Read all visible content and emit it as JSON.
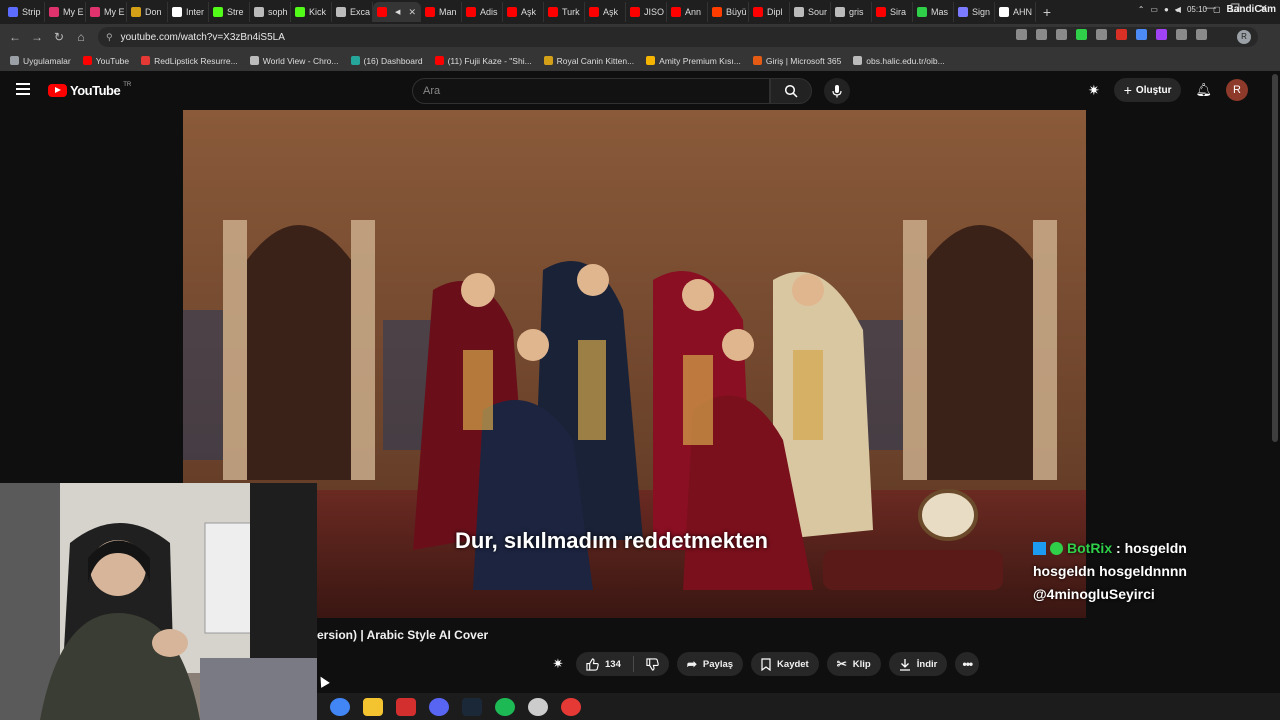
{
  "browser": {
    "tabs": [
      {
        "label": "Strip",
        "favicon": "#5b6cff"
      },
      {
        "label": "My E",
        "favicon": "#e0336e"
      },
      {
        "label": "My E",
        "favicon": "#e0336e"
      },
      {
        "label": "Don",
        "favicon": "#d4a017"
      },
      {
        "label": "Inter",
        "favicon": "#ffffff"
      },
      {
        "label": "Stre",
        "favicon": "#53fc18"
      },
      {
        "label": "soph",
        "favicon": "#bbbbbb"
      },
      {
        "label": "Kick",
        "favicon": "#53fc18"
      },
      {
        "label": "Exca",
        "favicon": "#bbbbbb"
      },
      {
        "label": "",
        "favicon": "#ff0000",
        "active": true
      },
      {
        "label": "Man",
        "favicon": "#ff0000"
      },
      {
        "label": "Adis",
        "favicon": "#ff0000"
      },
      {
        "label": "Aşk",
        "favicon": "#ff0000"
      },
      {
        "label": "Turk",
        "favicon": "#ff0000"
      },
      {
        "label": "Aşk",
        "favicon": "#ff0000"
      },
      {
        "label": "JISO",
        "favicon": "#ff0000"
      },
      {
        "label": "Ann",
        "favicon": "#ff0000"
      },
      {
        "label": "Büyü",
        "favicon": "#ff3d00"
      },
      {
        "label": "Dipl",
        "favicon": "#ff0000"
      },
      {
        "label": "Sour",
        "favicon": "#bbbbbb"
      },
      {
        "label": "gris",
        "favicon": "#bbbbbb"
      },
      {
        "label": "Sira",
        "favicon": "#ff0000"
      },
      {
        "label": "Mas",
        "favicon": "#2fcf4a"
      },
      {
        "label": "Sign",
        "favicon": "#7b7bff"
      },
      {
        "label": "AHN",
        "favicon": "#ffffff"
      }
    ],
    "url": "youtube.com/watch?v=X3zBn4iS5LA",
    "profile_initial": "R",
    "bookmarks": [
      {
        "label": "Uygulamalar",
        "color": "#9aa0a6"
      },
      {
        "label": "YouTube",
        "color": "#ff0000"
      },
      {
        "label": "RedLipstick Resurre...",
        "color": "#e53935"
      },
      {
        "label": "World View - Chro...",
        "color": "#bbbbbb"
      },
      {
        "label": "(16) Dashboard",
        "color": "#26a69a"
      },
      {
        "label": "(11) Fujii Kaze - \"Shi...",
        "color": "#ff0000"
      },
      {
        "label": "Royal Canin Kitten...",
        "color": "#d4a017"
      },
      {
        "label": "Amity Premium Kısı...",
        "color": "#f4b400"
      },
      {
        "label": "Giriş | Microsoft 365",
        "color": "#e55b13"
      },
      {
        "label": "obs.halic.edu.tr/oib...",
        "color": "#bbbbbb"
      }
    ]
  },
  "youtube": {
    "logo_text": "YouTube",
    "country_code": "TR",
    "search_placeholder": "Ara",
    "create_label": "Oluştur",
    "avatar_initial": "R"
  },
  "video": {
    "subtitle": "Dur, sıkılmadım reddetmekten",
    "title": "ersion) | Arabic Style AI Cover",
    "like_count": "134",
    "share_label": "Paylaş",
    "save_label": "Kaydet",
    "clip_label": "Klip",
    "download_label": "İndir"
  },
  "chat": {
    "username": "BotRix",
    "separator": ":",
    "message_start": "hosgeldn",
    "message_rest": "hosgeldn hosgeldnnnn @4minogluSeyirci"
  },
  "taskbar": {
    "clock": "05:10",
    "watermark": "BandiCam",
    "icons": [
      {
        "name": "chrome",
        "color": "#4285f4"
      },
      {
        "name": "files",
        "color": "#f4c430"
      },
      {
        "name": "news",
        "color": "#d32f2f"
      },
      {
        "name": "discord",
        "color": "#5865f2"
      },
      {
        "name": "steam",
        "color": "#1b2838"
      },
      {
        "name": "spotify",
        "color": "#1db954"
      },
      {
        "name": "obs",
        "color": "#cccccc"
      },
      {
        "name": "app",
        "color": "#e53935"
      }
    ]
  }
}
